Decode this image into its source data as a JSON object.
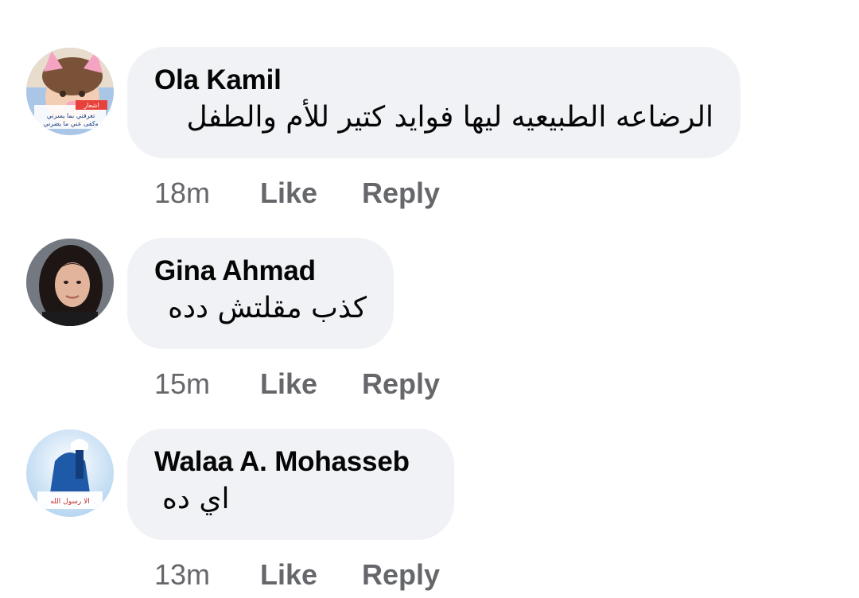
{
  "comments": [
    {
      "author": "Ola Kamil",
      "text": "الرضاعه الطبيعيه ليها فوايد كتير للأم والطفل",
      "time": "18m",
      "like_label": "Like",
      "reply_label": "Reply"
    },
    {
      "author": "Gina Ahmad",
      "text": "كذب مقلتش دده",
      "time": "15m",
      "like_label": "Like",
      "reply_label": "Reply"
    },
    {
      "author": "Walaa A. Mohasseb",
      "text": "اي ده",
      "time": "13m",
      "like_label": "Like",
      "reply_label": "Reply"
    }
  ],
  "avatar_texts": {
    "ola_line1": "اشعار",
    "ola_line2": "تعرفني بما يسرني",
    "ola_line3": "وكفى عني ما يضرني",
    "walaa_banner": "الا رسول الله"
  },
  "colors": {
    "bubble": "#f0f2f5",
    "author_text": "#050505",
    "action_text": "#65676b",
    "background": "#ffffff"
  }
}
